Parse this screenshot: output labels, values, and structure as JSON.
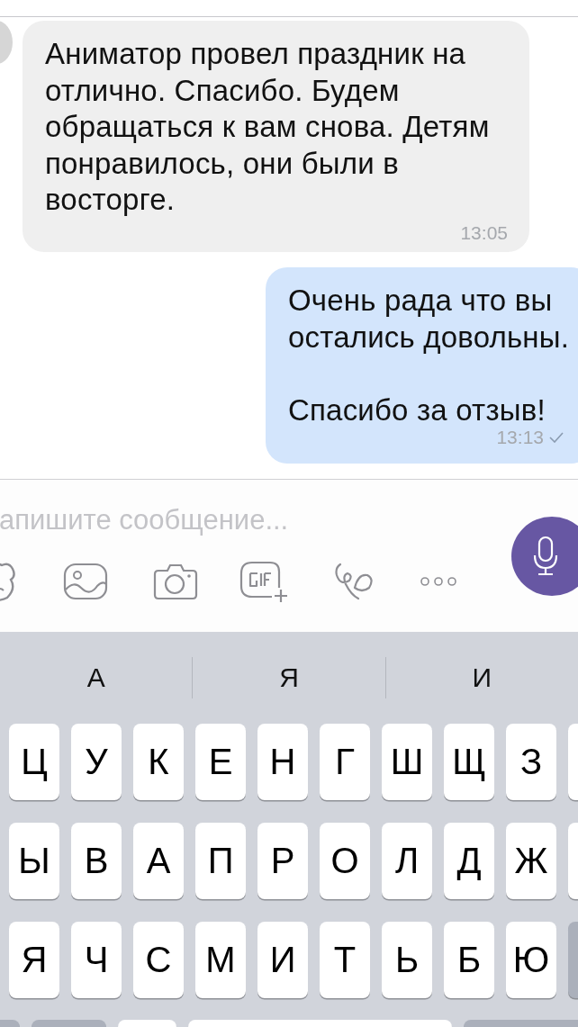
{
  "messages": [
    {
      "kind": "incoming",
      "text": "Аниматор провел праздник на\nотлично. Спасибо. Будем\nобращаться к вам снова. Детям\nпонравилось, они были в\nвосторге.",
      "time": "13:05",
      "delivered": false
    },
    {
      "kind": "outgoing",
      "text": "Очень рада что вы\nостались довольны.\n\nСпасибо за отзыв!",
      "time": "13:13",
      "delivered": true
    }
  ],
  "composer": {
    "placeholder": "апишите сообщение..."
  },
  "keyboard": {
    "suggestions": [
      "А",
      "Я",
      "И"
    ],
    "rows": [
      [
        "Ц",
        "У",
        "К",
        "Е",
        "Н",
        "Г",
        "Ш",
        "Щ",
        "З"
      ],
      [
        "Ы",
        "В",
        "А",
        "П",
        "Р",
        "О",
        "Л",
        "Д",
        "Ж"
      ],
      [
        "Я",
        "Ч",
        "С",
        "М",
        "И",
        "Т",
        "Ь",
        "Б",
        "Ю"
      ]
    ]
  }
}
